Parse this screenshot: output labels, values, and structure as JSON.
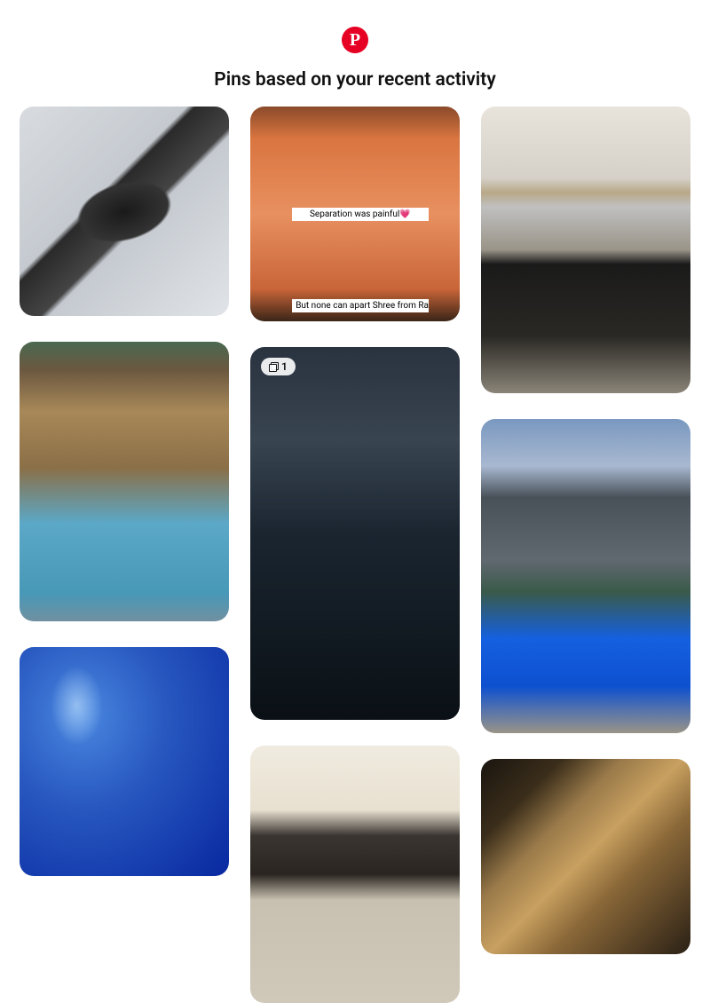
{
  "header": {
    "logo_letter": "P",
    "heading": "Pins based on your recent activity"
  },
  "badge": {
    "count": "1"
  },
  "pins": {
    "cartoon_caption_top": "Separation was painful💗",
    "cartoon_caption_bottom": "But none can apart Shree from Ram❤️"
  },
  "colors": {
    "brand": "#e60023"
  }
}
